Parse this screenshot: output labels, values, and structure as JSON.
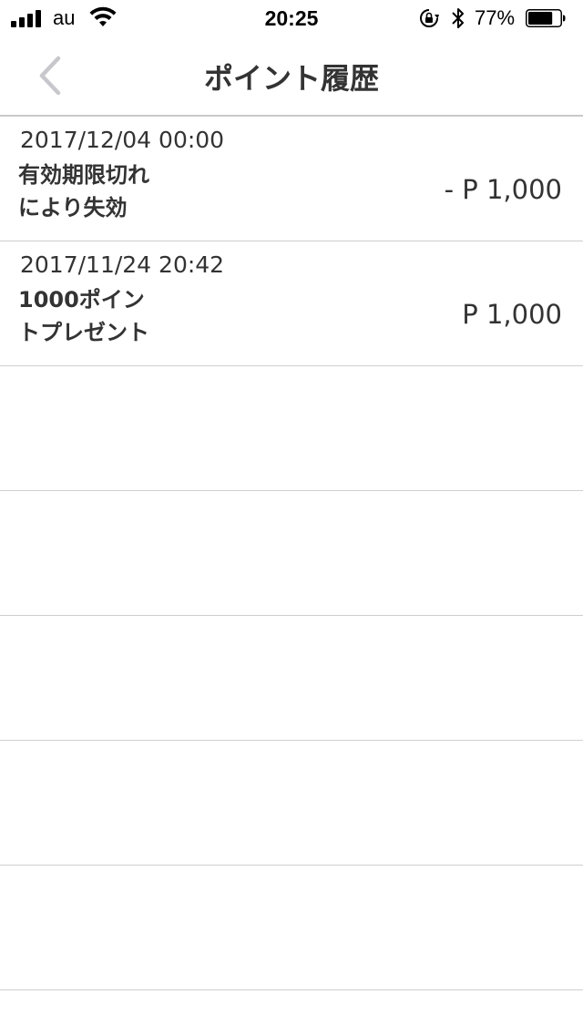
{
  "status_bar": {
    "carrier": "au",
    "time": "20:25",
    "battery_percent": "77%",
    "battery_level": 0.77,
    "signal_bars": 4,
    "icons": [
      "signal-icon",
      "wifi-icon",
      "rotation-lock-icon",
      "bluetooth-icon",
      "battery-icon"
    ]
  },
  "nav": {
    "title": "ポイント履歴",
    "back_icon": "chevron-left-icon"
  },
  "history": [
    {
      "date": "2017/12/04 00:00",
      "desc_line1": "有効期限切れ",
      "desc_line2": "により失効",
      "amount": "- P 1,000"
    },
    {
      "date": "2017/11/24 20:42",
      "desc_line1": "1000ポイン",
      "desc_line2": "トプレゼント",
      "amount": "P 1,000"
    }
  ],
  "empty_rows": 5,
  "colors": {
    "text": "#333333",
    "separator": "#cfcfcf",
    "back_chevron": "#c7c7cc",
    "background": "#ffffff"
  }
}
